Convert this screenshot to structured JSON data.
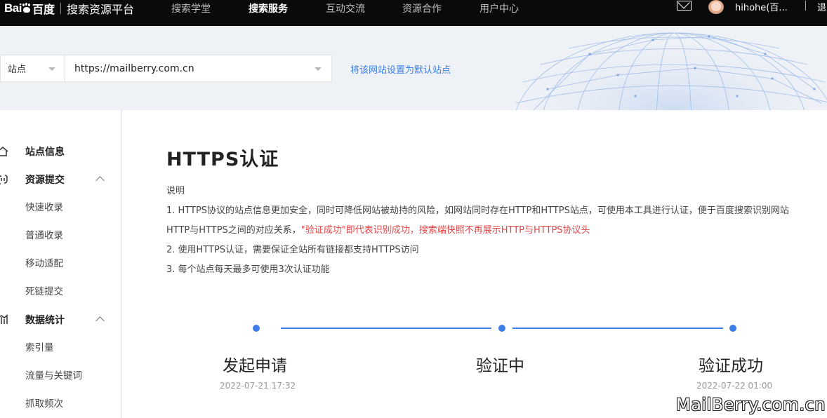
{
  "header": {
    "logo_bai": "Bai",
    "logo_du": "百度",
    "platform": "搜索资源平台",
    "nav": [
      "搜索学堂",
      "搜索服务",
      "互动交流",
      "资源合作",
      "用户中心"
    ],
    "active_nav": "搜索服务",
    "username": "hihohe(百...",
    "logout": "退"
  },
  "site_bar": {
    "type_label": "站点",
    "site_url": "https://mailberry.com.cn",
    "default_link": "将该网站设置为默认站点"
  },
  "sidebar": {
    "site_info": "站点信息",
    "resource_submit": "资源提交",
    "resource_items": [
      "快速收录",
      "普通收录",
      "移动适配",
      "死链提交"
    ],
    "data_stats": "数据统计",
    "data_items": [
      "索引量",
      "流量与关键词",
      "抓取频次"
    ]
  },
  "main": {
    "title": "HTTPS认证",
    "desc_heading": "说明",
    "desc_line1": "1. HTTPS协议的站点信息更加安全，同时可降低网站被劫持的风险，如网站同时存在HTTP和HTTPS站点，可使用本工具进行认证，便于百度搜索识别网站",
    "desc_line2_prefix": "HTTP与HTTPS之间的对应关系，",
    "desc_line2_red": "\"验证成功\"即代表识别成功，搜索端快照不再展示HTTP与HTTPS协议头",
    "desc_line3": "2. 使用HTTPS认证，需要保证全站所有链接都支持HTTPS访问",
    "desc_line4": "3. 每个站点每天最多可使用3次认证功能",
    "steps": [
      {
        "label": "发起申请",
        "time": "2022-07-21 17:32"
      },
      {
        "label": "验证中",
        "time": ""
      },
      {
        "label": "验证成功",
        "time": "2022-07-22 01:00"
      }
    ]
  },
  "watermark": "MailBerry.com.cn",
  "colors": {
    "accent": "#3c7ee8",
    "warning_text": "#e34646",
    "topbar": "#0a0a0a"
  }
}
